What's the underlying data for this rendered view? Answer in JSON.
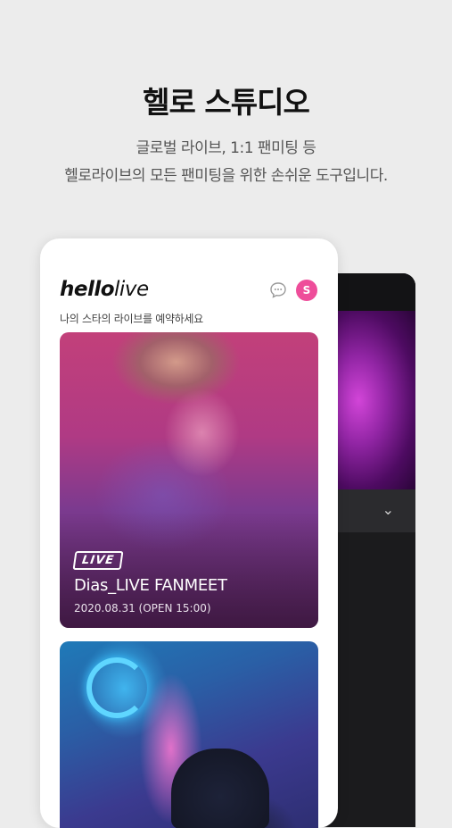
{
  "headline": "헬로 스튜디오",
  "subtitle_line1": "글로벌 라이브, 1:1 팬미팅 등",
  "subtitle_line2": "헬로라이브의 모든 팬미팅을 위한 손쉬운 도구입니다.",
  "app": {
    "logo_bold": "hello",
    "logo_light": "live",
    "avatar_initial": "S",
    "tagline": "나의 스타의 라이브를 예약하세요"
  },
  "cards": [
    {
      "badge": "LIVE",
      "title": "Dias_LIVE FANMEET",
      "date": "2020.08.31 (OPEN 15:00)"
    }
  ],
  "colors": {
    "accent_pink": "#ee4d9a",
    "background": "#ececec"
  }
}
